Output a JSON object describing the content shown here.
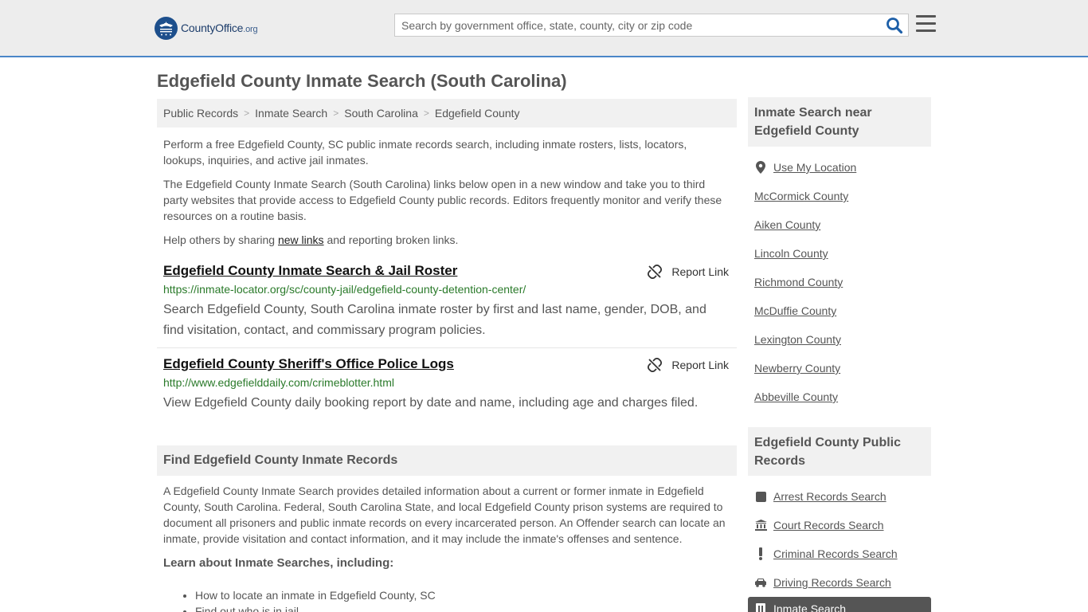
{
  "brand": {
    "name": "CountyOffice",
    "tld": ".org"
  },
  "search": {
    "placeholder": "Search by government office, state, county, city or zip code"
  },
  "page": {
    "title": "Edgefield County Inmate Search (South Carolina)"
  },
  "breadcrumb": [
    "Public Records",
    "Inmate Search",
    "South Carolina",
    "Edgefield County"
  ],
  "intro": {
    "p1": "Perform a free Edgefield County, SC public inmate records search, including inmate rosters, lists, locators, lookups, inquiries, and active jail inmates.",
    "p2": "The Edgefield County Inmate Search (South Carolina) links below open in a new window and take you to third party websites that provide access to Edgefield County public records. Editors frequently monitor and verify these resources on a routine basis.",
    "p3_before": "Help others by sharing ",
    "p3_link": "new links",
    "p3_after": " and reporting broken links."
  },
  "links": [
    {
      "title": "Edgefield County Inmate Search & Jail Roster",
      "url": "https://inmate-locator.org/sc/county-jail/edgefield-county-detention-center/",
      "desc": "Search Edgefield County, South Carolina inmate roster by first and last name, gender, DOB, and find visitation, contact, and commissary program policies.",
      "report": "Report Link"
    },
    {
      "title": "Edgefield County Sheriff's Office Police Logs",
      "url": "http://www.edgefielddaily.com/crimeblotter.html",
      "desc": "View Edgefield County daily booking report by date and name, including age and charges filed.",
      "report": "Report Link"
    }
  ],
  "section": {
    "heading": "Find Edgefield County Inmate Records",
    "body": "A Edgefield County Inmate Search provides detailed information about a current or former inmate in Edgefield County, South Carolina. Federal, South Carolina State, and local Edgefield County prison systems are required to document all prisoners and public inmate records on every incarcerated person. An Offender search can locate an inmate, provide visitation and contact information, and it may include the inmate's offenses and sentence.",
    "learn": "Learn about Inmate Searches, including:",
    "bullets": [
      "How to locate an inmate in Edgefield County, SC",
      "Find out who is in jail"
    ]
  },
  "sidebar": {
    "near_heading": "Inmate Search near Edgefield County",
    "use_location": "Use My Location",
    "nearby": [
      "McCormick County",
      "Aiken County",
      "Lincoln County",
      "Richmond County",
      "McDuffie County",
      "Lexington County",
      "Newberry County",
      "Abbeville County"
    ],
    "records_heading": "Edgefield County Public Records",
    "records": [
      {
        "label": "Arrest Records Search",
        "icon": "square-icon"
      },
      {
        "label": "Court Records Search",
        "icon": "courthouse-icon"
      },
      {
        "label": "Criminal Records Search",
        "icon": "exclamation-icon"
      },
      {
        "label": "Driving Records Search",
        "icon": "car-icon"
      }
    ],
    "active": {
      "label": "Inmate Search",
      "icon": "jail-icon"
    }
  }
}
